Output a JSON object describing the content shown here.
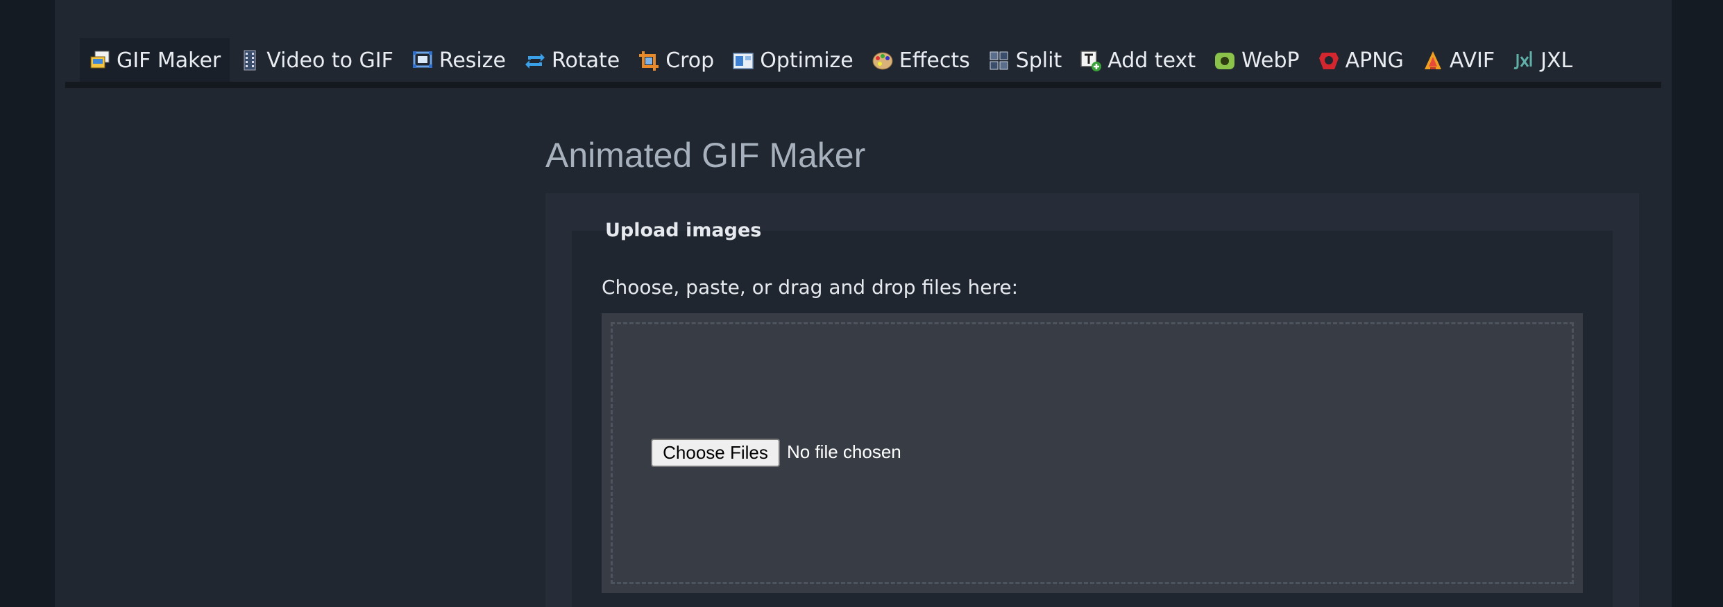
{
  "nav": {
    "items": [
      {
        "label": "GIF Maker",
        "icon": "gif-maker-icon",
        "active": true
      },
      {
        "label": "Video to GIF",
        "icon": "film-icon"
      },
      {
        "label": "Resize",
        "icon": "resize-icon"
      },
      {
        "label": "Rotate",
        "icon": "rotate-icon"
      },
      {
        "label": "Crop",
        "icon": "crop-icon"
      },
      {
        "label": "Optimize",
        "icon": "optimize-icon"
      },
      {
        "label": "Effects",
        "icon": "palette-icon"
      },
      {
        "label": "Split",
        "icon": "split-icon"
      },
      {
        "label": "Add text",
        "icon": "add-text-icon"
      },
      {
        "label": "WebP",
        "icon": "webp-icon"
      },
      {
        "label": "APNG",
        "icon": "apng-icon"
      },
      {
        "label": "AVIF",
        "icon": "avif-icon"
      },
      {
        "label": "JXL",
        "icon": "jxl-icon"
      }
    ]
  },
  "main": {
    "title": "Animated GIF Maker",
    "upload": {
      "legend": "Upload images",
      "instructions": "Choose, paste, or drag and drop files here:",
      "button_label": "Choose Files",
      "status": "No file chosen"
    }
  },
  "colors": {
    "background": "#151b22",
    "page": "#212731",
    "nav_text": "#e9edf2",
    "title": "#a7b1bd",
    "dropzone": "#373c45"
  }
}
